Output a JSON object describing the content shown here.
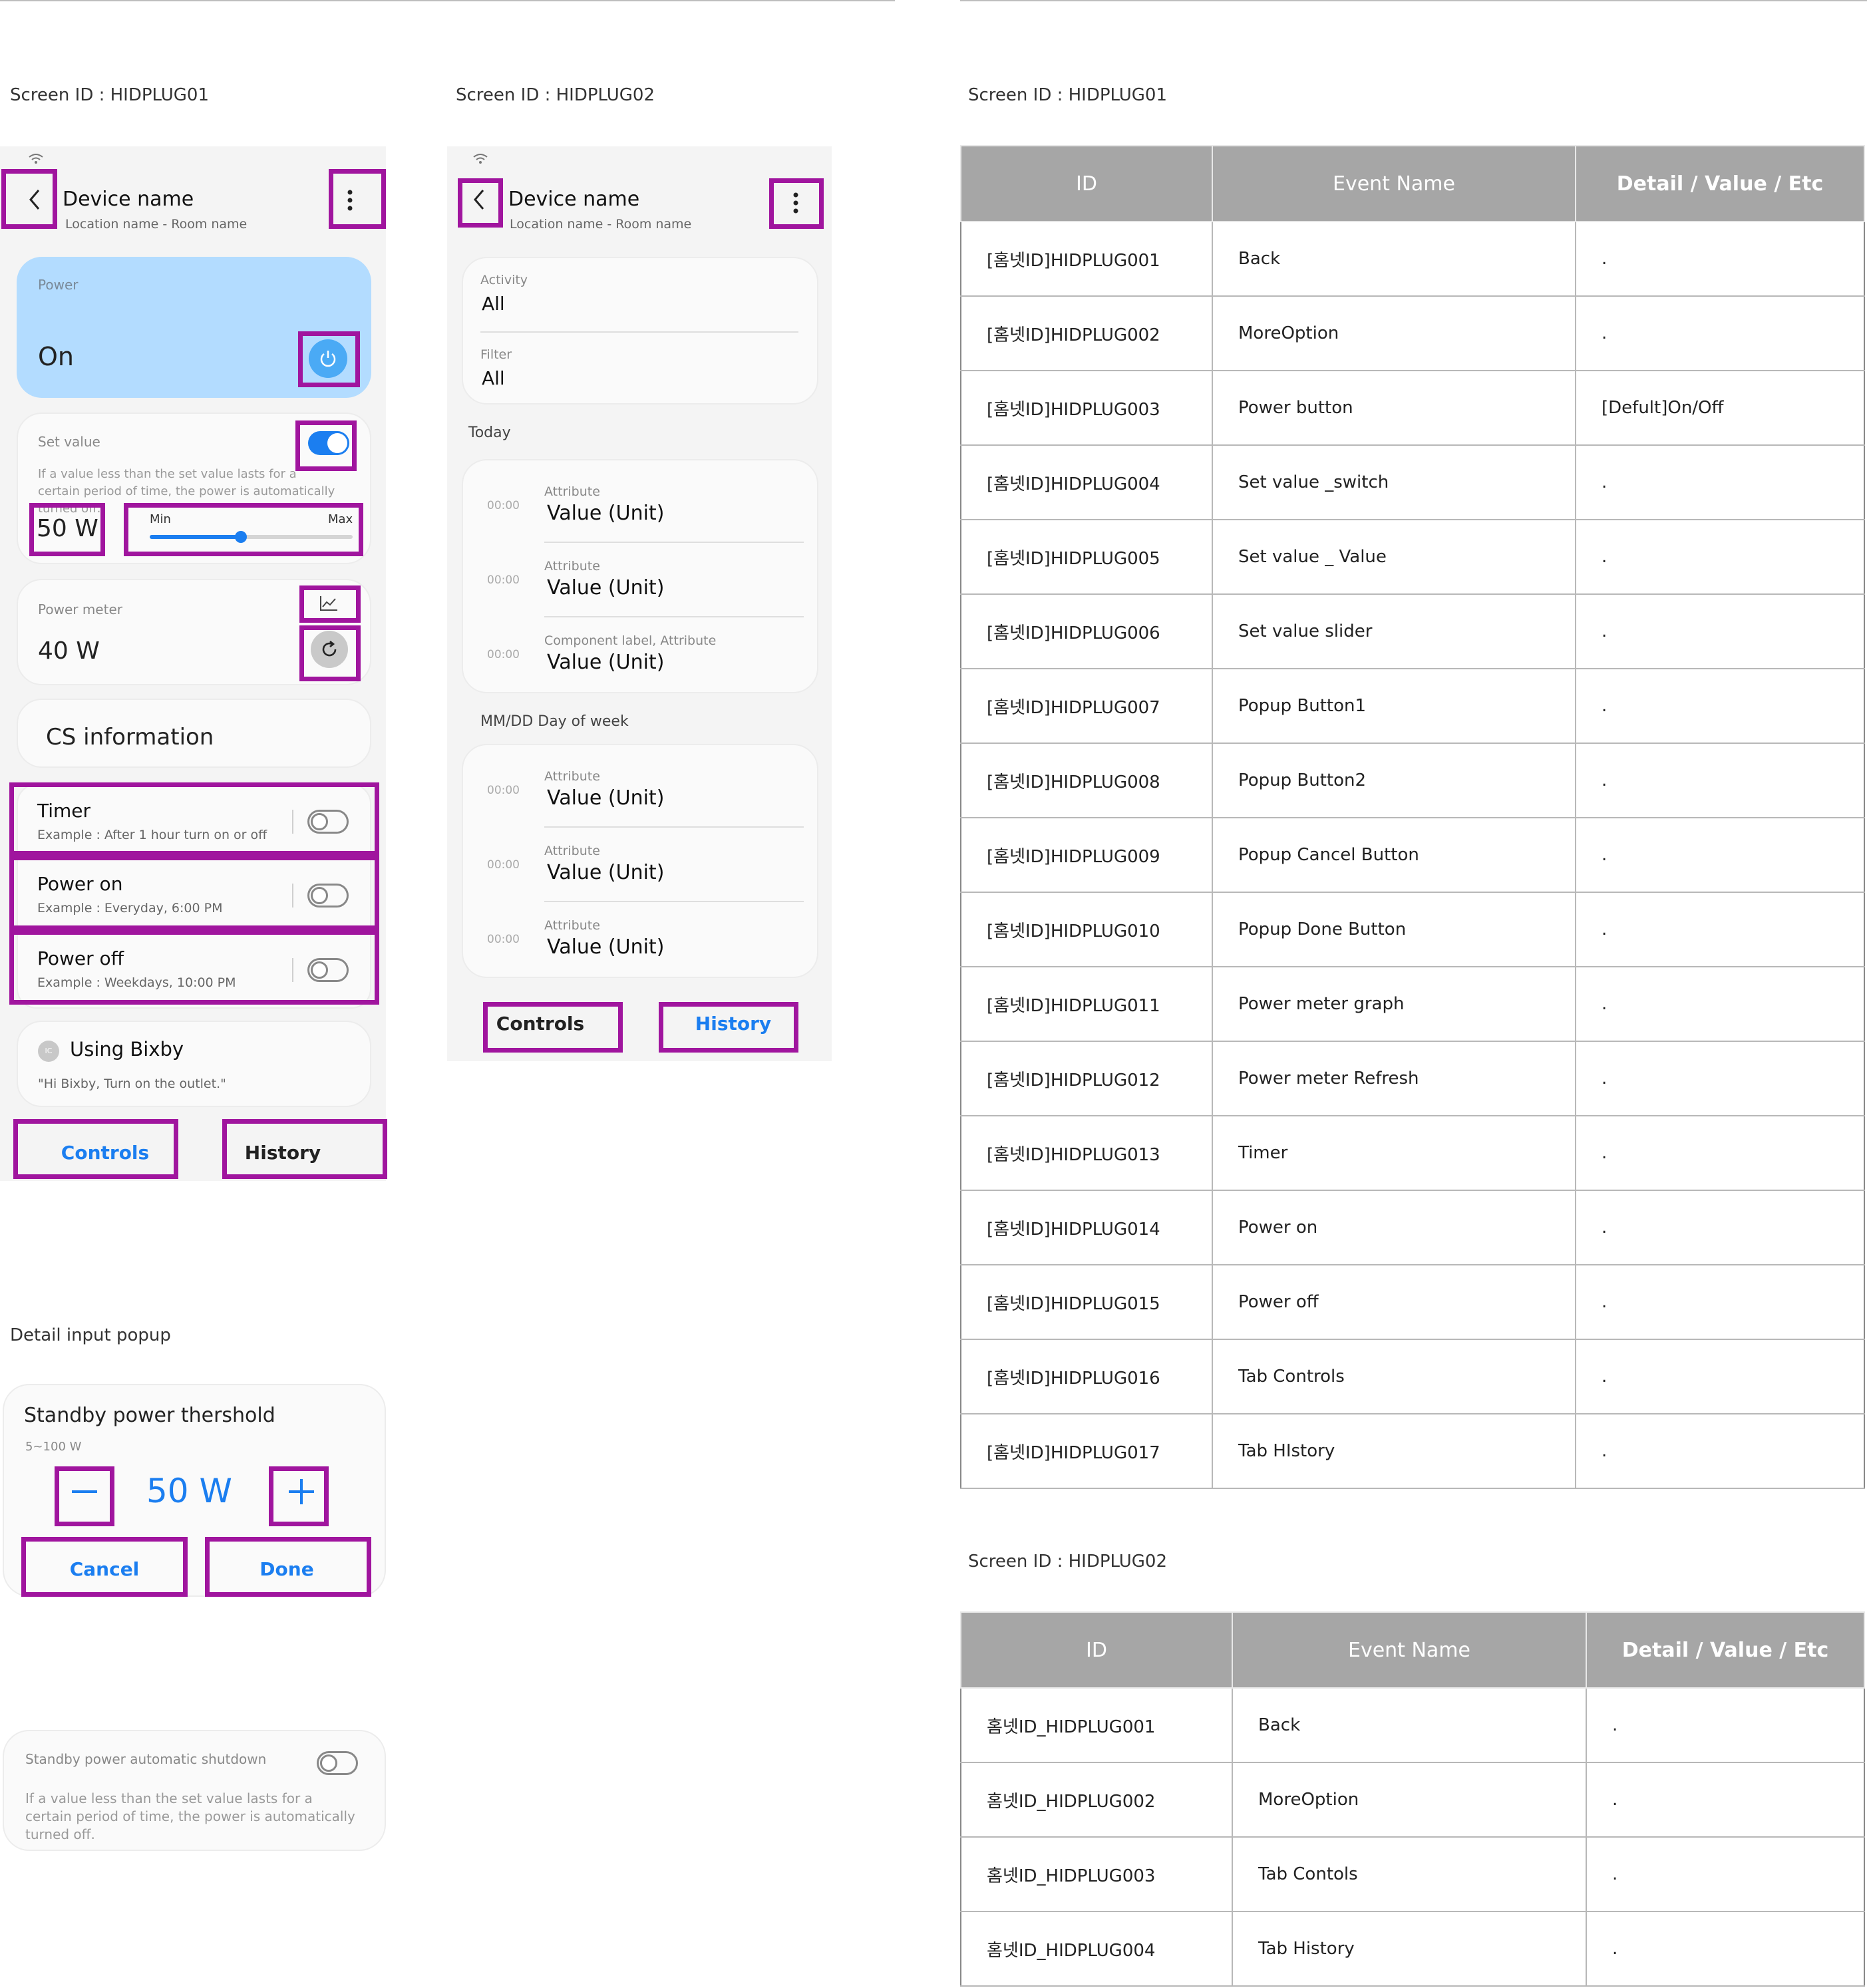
{
  "labels": {
    "screen1": "Screen ID : HIDPLUG01",
    "screen2": "Screen ID : HIDPLUG02",
    "table1": "Screen ID : HIDPLUG01",
    "table2": "Screen ID : HIDPLUG02",
    "popup": "Detail input popup"
  },
  "screen1": {
    "title": "Device name",
    "subtitle": "Location name - Room name",
    "power_label": "Power",
    "power_state": "On",
    "set_value_label": "Set value",
    "set_value_desc": "If a value less than the set value lasts for a certain period of time, the power is automatically turned off.",
    "set_value": "50 W",
    "slider_min": "Min",
    "slider_max": "Max",
    "slider_fraction": 0.45,
    "power_meter_label": "Power meter",
    "power_meter_value": "40 W",
    "cs_info": "CS information",
    "timer_title": "Timer",
    "timer_desc": "Example : After 1 hour turn on or off",
    "power_on_title": "Power on",
    "power_on_desc": "Example : Everyday, 6:00 PM",
    "power_off_title": "Power off",
    "power_off_desc": "Example : Weekdays, 10:00 PM",
    "bixby_badge": "IC",
    "bixby_title": "Using Bixby",
    "bixby_desc": "\"Hi Bixby, Turn on the outlet.\"",
    "tab_controls": "Controls",
    "tab_history": "History"
  },
  "screen2": {
    "title": "Device name",
    "subtitle": "Location name - Room name",
    "activity_label": "Activity",
    "activity_value": "All",
    "filter_label": "Filter",
    "filter_value": "All",
    "group1": "Today",
    "group1_items": [
      {
        "time": "00:00",
        "attr": "Attribute",
        "value": "Value (Unit)"
      },
      {
        "time": "00:00",
        "attr": "Attribute",
        "value": "Value (Unit)"
      },
      {
        "time": "00:00",
        "attr": "Component label, Attribute",
        "value": "Value (Unit)"
      }
    ],
    "group2": "MM/DD Day of week",
    "group2_items": [
      {
        "time": "00:00",
        "attr": "Attribute",
        "value": "Value (Unit)"
      },
      {
        "time": "00:00",
        "attr": "Attribute",
        "value": "Value (Unit)"
      },
      {
        "time": "00:00",
        "attr": "Attribute",
        "value": "Value (Unit)"
      }
    ],
    "tab_controls": "Controls",
    "tab_history": "History"
  },
  "popup": {
    "title": "Standby power thershold",
    "range": "5~100 W",
    "value": "50 W",
    "cancel": "Cancel",
    "done": "Done"
  },
  "shutdown_card": {
    "title": "Standby power automatic shutdown",
    "desc": "If a value less than the set value lasts for a certain period of time, the power is automatically turned off."
  },
  "table1": {
    "headers": [
      "ID",
      "Event Name",
      "Detail / Value / Etc"
    ],
    "rows": [
      [
        "[홈넷ID]HIDPLUG001",
        "Back",
        "."
      ],
      [
        "[홈넷ID]HIDPLUG002",
        "MoreOption",
        "."
      ],
      [
        "[홈넷ID]HIDPLUG003",
        "Power button",
        "[Defult]On/Off"
      ],
      [
        "[홈넷ID]HIDPLUG004",
        "Set value _switch",
        "."
      ],
      [
        "[홈넷ID]HIDPLUG005",
        "Set value _ Value",
        "."
      ],
      [
        "[홈넷ID]HIDPLUG006",
        "Set value slider",
        "."
      ],
      [
        "[홈넷ID]HIDPLUG007",
        "Popup Button1",
        "."
      ],
      [
        "[홈넷ID]HIDPLUG008",
        "Popup  Button2",
        "."
      ],
      [
        "[홈넷ID]HIDPLUG009",
        "Popup  Cancel Button",
        "."
      ],
      [
        "[홈넷ID]HIDPLUG010",
        "Popup   Done Button",
        "."
      ],
      [
        "[홈넷ID]HIDPLUG011",
        "Power meter graph",
        "."
      ],
      [
        "[홈넷ID]HIDPLUG012",
        "Power meter Refresh",
        "."
      ],
      [
        "[홈넷ID]HIDPLUG013",
        "Timer",
        "."
      ],
      [
        "[홈넷ID]HIDPLUG014",
        "Power on",
        "."
      ],
      [
        "[홈넷ID]HIDPLUG015",
        "Power off",
        "."
      ],
      [
        "[홈넷ID]HIDPLUG016",
        "Tab  Controls",
        "."
      ],
      [
        "[홈넷ID]HIDPLUG017",
        "Tab HIstory",
        "."
      ]
    ]
  },
  "table2": {
    "headers": [
      "ID",
      "Event Name",
      "Detail / Value / Etc"
    ],
    "rows": [
      [
        "홈넷ID_HIDPLUG001",
        "Back",
        "."
      ],
      [
        "홈넷ID_HIDPLUG002",
        "MoreOption",
        "."
      ],
      [
        "홈넷ID_HIDPLUG003",
        "Tab Contols",
        "."
      ],
      [
        "홈넷ID_HIDPLUG004",
        "Tab History",
        "."
      ]
    ]
  },
  "colors": {
    "highlight": "#a0159e",
    "accent_blue": "#1b7ef0",
    "power_card": "#b3dcff",
    "header_gray": "#a6a6a6"
  }
}
